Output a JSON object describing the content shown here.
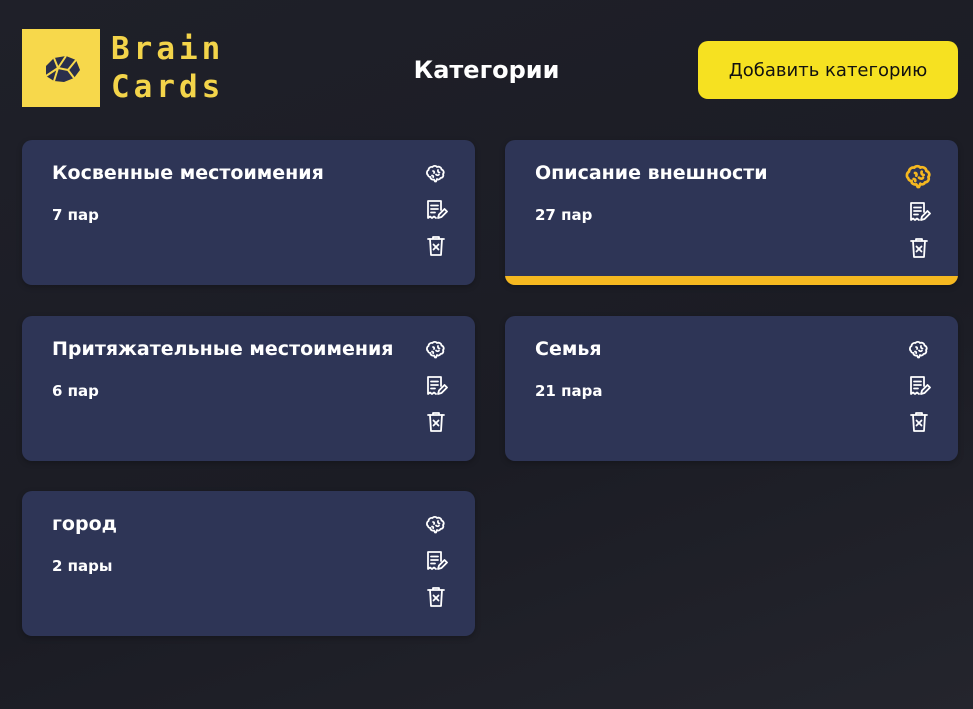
{
  "logo": {
    "line1": "Brain",
    "line2": "Cards",
    "icon": "brain-logo-icon",
    "tile_color": "#f7d84b",
    "text_color": "#f3d44a"
  },
  "header": {
    "title": "Категории",
    "add_button_label": "Добавить категорию",
    "accent": "#f6e121"
  },
  "colors": {
    "card_bg": "#2e3556",
    "active_accent": "#f5b820",
    "page_bg": "#1f2029"
  },
  "categories": [
    {
      "title": "Косвенные местоимения",
      "count": "7 пар",
      "active": false,
      "icons": [
        "brain-icon",
        "edit-icon",
        "trash-icon"
      ]
    },
    {
      "title": "Описание внешности",
      "count": "27 пар",
      "active": true,
      "icons": [
        "brain-icon",
        "edit-icon",
        "trash-icon"
      ]
    },
    {
      "title": "Притяжательные местоимения",
      "count": "6 пар",
      "active": false,
      "icons": [
        "brain-icon",
        "edit-icon",
        "trash-icon"
      ]
    },
    {
      "title": "Семья",
      "count": "21 пара",
      "active": false,
      "icons": [
        "brain-icon",
        "edit-icon",
        "trash-icon"
      ]
    },
    {
      "title": "город",
      "count": "2 пары",
      "active": false,
      "icons": [
        "brain-icon",
        "edit-icon",
        "trash-icon"
      ]
    }
  ]
}
